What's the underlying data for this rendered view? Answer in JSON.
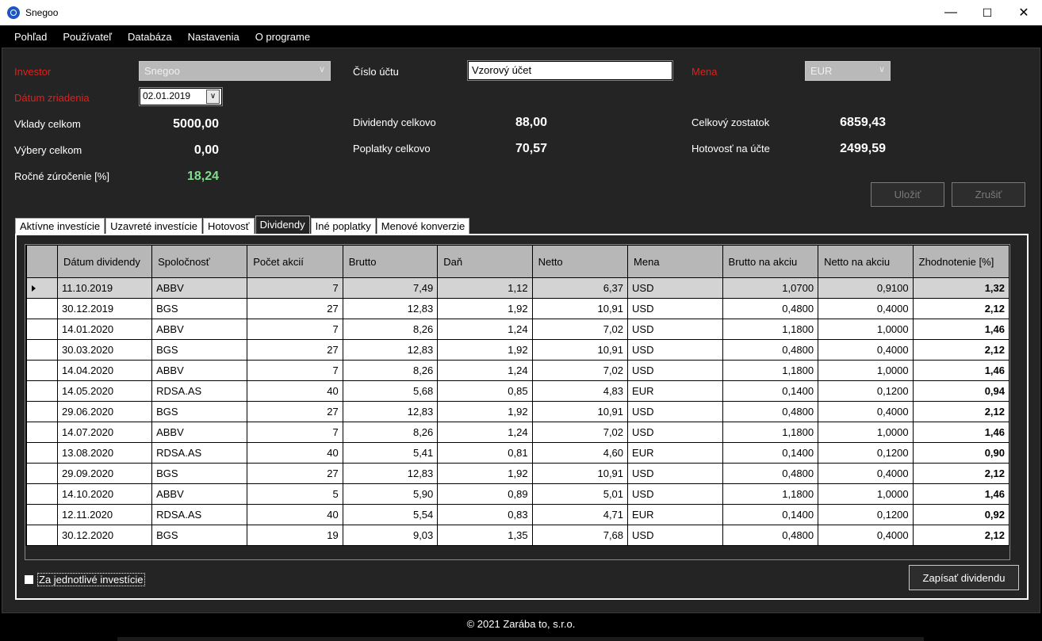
{
  "window": {
    "title": "Snegoo",
    "minimize": "—",
    "maximize": "☐",
    "close": "✕"
  },
  "menu": [
    "Pohľad",
    "Používateľ",
    "Databáza",
    "Nastavenia",
    "O programe"
  ],
  "form": {
    "investor_label": "Investor",
    "investor_value": "Snegoo",
    "account_label": "Číslo účtu",
    "account_value": "Vzorový účet",
    "currency_label": "Mena",
    "currency_value": "EUR",
    "date_label": "Dátum zriadenia",
    "date_value": "02.01.2019",
    "deposits_label": "Vklady celkom",
    "deposits_value": "5000,00",
    "withdrawals_label": "Výbery celkom",
    "withdrawals_value": "0,00",
    "annual_label": "Ročné zúročenie [%]",
    "annual_value": "18,24",
    "dividends_label": "Dividendy celkovo",
    "dividends_value": "88,00",
    "fees_label": "Poplatky celkovo",
    "fees_value": "70,57",
    "balance_label": "Celkový zostatok",
    "balance_value": "6859,43",
    "cash_label": "Hotovosť na účte",
    "cash_value": "2499,59",
    "save_label": "Uložiť",
    "cancel_label": "Zrušiť"
  },
  "tabs": [
    {
      "label": "Aktívne investície",
      "active": false
    },
    {
      "label": "Uzavreté investície",
      "active": false
    },
    {
      "label": "Hotovosť",
      "active": false
    },
    {
      "label": "Dividendy",
      "active": true
    },
    {
      "label": "Iné poplatky",
      "active": false
    },
    {
      "label": "Menové konverzie",
      "active": false
    }
  ],
  "table": {
    "columns": [
      "Dátum dividendy",
      "Spoločnosť",
      "Počet akcií",
      "Brutto",
      "Daň",
      "Netto",
      "Mena",
      "Brutto na akciu",
      "Netto na akciu",
      "Zhodnotenie [%]"
    ],
    "rows": [
      [
        "11.10.2019",
        "ABBV",
        "7",
        "7,49",
        "1,12",
        "6,37",
        "USD",
        "1,0700",
        "0,9100",
        "1,32"
      ],
      [
        "30.12.2019",
        "BGS",
        "27",
        "12,83",
        "1,92",
        "10,91",
        "USD",
        "0,4800",
        "0,4000",
        "2,12"
      ],
      [
        "14.01.2020",
        "ABBV",
        "7",
        "8,26",
        "1,24",
        "7,02",
        "USD",
        "1,1800",
        "1,0000",
        "1,46"
      ],
      [
        "30.03.2020",
        "BGS",
        "27",
        "12,83",
        "1,92",
        "10,91",
        "USD",
        "0,4800",
        "0,4000",
        "2,12"
      ],
      [
        "14.04.2020",
        "ABBV",
        "7",
        "8,26",
        "1,24",
        "7,02",
        "USD",
        "1,1800",
        "1,0000",
        "1,46"
      ],
      [
        "14.05.2020",
        "RDSA.AS",
        "40",
        "5,68",
        "0,85",
        "4,83",
        "EUR",
        "0,1400",
        "0,1200",
        "0,94"
      ],
      [
        "29.06.2020",
        "BGS",
        "27",
        "12,83",
        "1,92",
        "10,91",
        "USD",
        "0,4800",
        "0,4000",
        "2,12"
      ],
      [
        "14.07.2020",
        "ABBV",
        "7",
        "8,26",
        "1,24",
        "7,02",
        "USD",
        "1,1800",
        "1,0000",
        "1,46"
      ],
      [
        "13.08.2020",
        "RDSA.AS",
        "40",
        "5,41",
        "0,81",
        "4,60",
        "EUR",
        "0,1400",
        "0,1200",
        "0,90"
      ],
      [
        "29.09.2020",
        "BGS",
        "27",
        "12,83",
        "1,92",
        "10,91",
        "USD",
        "0,4800",
        "0,4000",
        "2,12"
      ],
      [
        "14.10.2020",
        "ABBV",
        "5",
        "5,90",
        "0,89",
        "5,01",
        "USD",
        "1,1800",
        "1,0000",
        "1,46"
      ],
      [
        "12.11.2020",
        "RDSA.AS",
        "40",
        "5,54",
        "0,83",
        "4,71",
        "EUR",
        "0,1400",
        "0,1200",
        "0,92"
      ],
      [
        "30.12.2020",
        "BGS",
        "19",
        "9,03",
        "1,35",
        "7,68",
        "USD",
        "0,4800",
        "0,4000",
        "2,12"
      ]
    ]
  },
  "per_investment_label": "Za jednotlivé investície",
  "write_dividends_label": "Zapísať dividendu",
  "footer": "© 2021 Zarába to, s.r.o."
}
